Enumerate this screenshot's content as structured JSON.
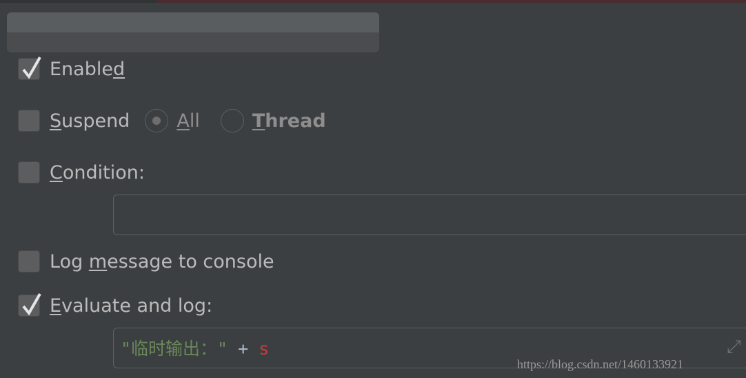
{
  "enabled": {
    "pre": "Enable",
    "mn": "d",
    "post": "",
    "checked": true
  },
  "suspend": {
    "pre": "",
    "mn": "S",
    "post": "uspend",
    "checked": false,
    "options": [
      {
        "pre": "",
        "mn": "A",
        "post": "ll",
        "selected": true
      },
      {
        "pre": "",
        "mn": "T",
        "post": "hread",
        "selected": false
      }
    ]
  },
  "condition": {
    "pre": "",
    "mn": "C",
    "post": "ondition:",
    "checked": false,
    "value": ""
  },
  "log_message": {
    "pre": "Log ",
    "mn": "m",
    "post": "essage to console",
    "checked": false
  },
  "evaluate": {
    "pre": "",
    "mn": "E",
    "post": "valuate and log:",
    "checked": true,
    "code": {
      "string": "\"临时输出：\"",
      "op": " + ",
      "var": "s"
    }
  },
  "watermark": "https://blog.csdn.net/1460133921",
  "colors": {
    "background": "#3c3f41",
    "text": "#bbbbbb",
    "string": "#6a8759",
    "variable": "#cc3c3c"
  }
}
